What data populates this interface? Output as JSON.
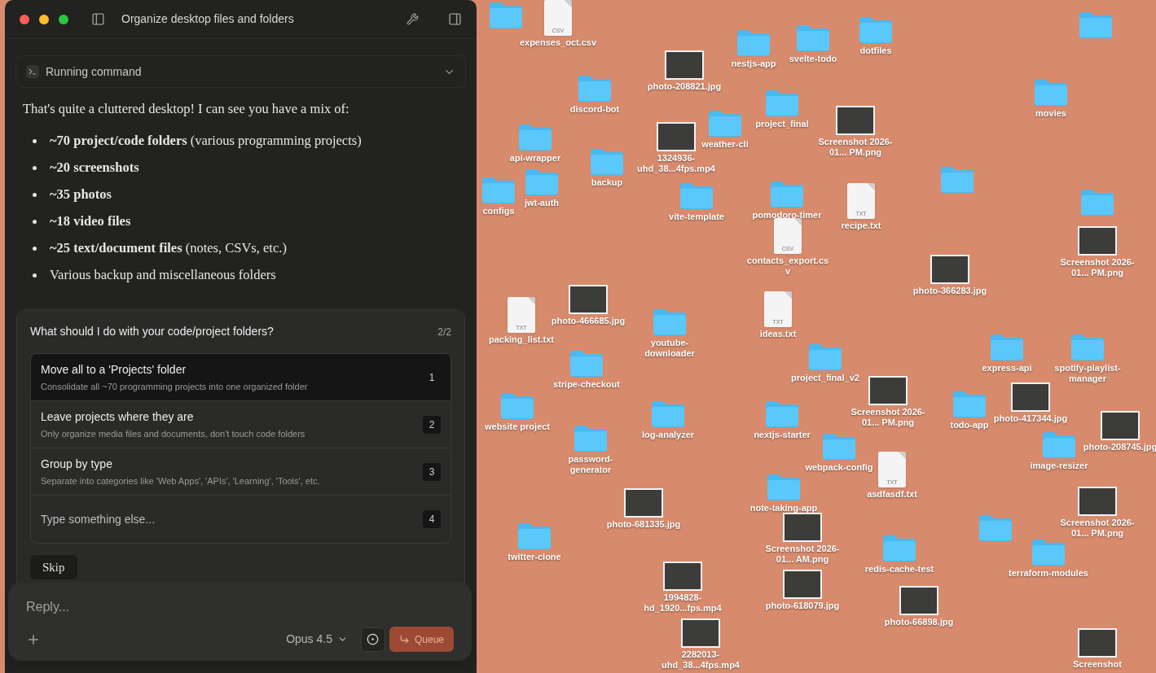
{
  "window": {
    "title": "Organize desktop files and folders"
  },
  "command": {
    "label": "Running command"
  },
  "message": {
    "intro": "That's quite a cluttered desktop! I can see you have a mix of:",
    "bullets": [
      "**~70 project/code folders** (various programming projects)",
      "**~20 screenshots**",
      "**~35 photos**",
      "**~18 video files**",
      "**~25 text/document files** (notes, CSVs, etc.)",
      "Various backup and miscellaneous folders"
    ]
  },
  "question": {
    "title": "What should I do with your code/project folders?",
    "counter": "2/2",
    "options": [
      {
        "kind": "choice",
        "title": "Move all to a 'Projects' folder",
        "description": "Consolidate all ~70 programming projects into one organized folder",
        "number": "1",
        "selected": true
      },
      {
        "kind": "choice",
        "title": "Leave projects where they are",
        "description": "Only organize media files and documents, don't touch code folders",
        "number": "2",
        "selected": false
      },
      {
        "kind": "choice",
        "title": "Group by type",
        "description": "Separate into categories like 'Web Apps', 'APIs', 'Learning', 'Tools', etc.",
        "number": "3",
        "selected": false
      },
      {
        "kind": "custom",
        "placeholder": "Type something else...",
        "number": "4",
        "selected": false
      }
    ],
    "skip": "Skip"
  },
  "composer": {
    "placeholder": "Reply...",
    "model": "Opus 4.5",
    "send": "Queue"
  },
  "desktop": {
    "items": [
      {
        "kind": "folder"
      },
      {
        "kind": "document",
        "type": "CSV",
        "label": "expenses_oct.csv"
      },
      {
        "kind": "folder",
        "label": "nestjs-app"
      },
      {
        "kind": "folder",
        "label": "svelte-todo"
      },
      {
        "kind": "folder",
        "label": "dotfiles"
      },
      {
        "kind": "folder"
      },
      {
        "kind": "image",
        "label": "photo-208821.jpg"
      },
      {
        "kind": "folder",
        "label": "discord-bot"
      },
      {
        "kind": "folder",
        "label": "movies"
      },
      {
        "kind": "folder",
        "label": "project_final"
      },
      {
        "kind": "folder",
        "label": "weather-cli"
      },
      {
        "kind": "image",
        "label": "Screenshot 2026-01... PM.png"
      },
      {
        "kind": "folder",
        "label": "api-wrapper"
      },
      {
        "kind": "image",
        "label": "1324936-uhd_38...4fps.mp4"
      },
      {
        "kind": "folder",
        "label": "backup"
      },
      {
        "kind": "folder",
        "label": "jwt-auth"
      },
      {
        "kind": "folder",
        "label": "configs"
      },
      {
        "kind": "folder",
        "label": "vite-template"
      },
      {
        "kind": "folder",
        "label": "pomodoro-timer"
      },
      {
        "kind": "document",
        "type": "TXT",
        "label": "recipe.txt"
      },
      {
        "kind": "folder"
      },
      {
        "kind": "folder"
      },
      {
        "kind": "document",
        "type": "CSV",
        "label": "contacts_export.csv"
      },
      {
        "kind": "image",
        "label": "Screenshot 2026-01... PM.png"
      },
      {
        "kind": "image",
        "label": "photo-366283.jpg"
      },
      {
        "kind": "image",
        "label": "photo-466685.jpg"
      },
      {
        "kind": "document",
        "type": "TXT",
        "label": "ideas.txt"
      },
      {
        "kind": "document",
        "type": "TXT",
        "label": "packing_list.txt"
      },
      {
        "kind": "folder",
        "label": "youtube-downloader"
      },
      {
        "kind": "folder",
        "label": "stripe-checkout"
      },
      {
        "kind": "folder",
        "label": "project_final_v2"
      },
      {
        "kind": "folder",
        "label": "express-api"
      },
      {
        "kind": "folder",
        "label": "spotify-playlist-manager"
      },
      {
        "kind": "folder",
        "label": "website project"
      },
      {
        "kind": "folder",
        "label": "log-analyzer"
      },
      {
        "kind": "folder",
        "label": "nextjs-starter"
      },
      {
        "kind": "image",
        "label": "Screenshot 2026-01... PM.png"
      },
      {
        "kind": "folder",
        "label": "todo-app"
      },
      {
        "kind": "image",
        "label": "photo-417344.jpg"
      },
      {
        "kind": "image",
        "label": "photo-208745.jpg"
      },
      {
        "kind": "folder",
        "label": "password-generator"
      },
      {
        "kind": "folder",
        "label": "webpack-config"
      },
      {
        "kind": "folder",
        "label": "image-resizer"
      },
      {
        "kind": "document",
        "type": "TXT",
        "label": "asdfasdf.txt"
      },
      {
        "kind": "folder",
        "label": "note-taking-app"
      },
      {
        "kind": "image",
        "label": "photo-681335.jpg"
      },
      {
        "kind": "image",
        "label": "Screenshot 2026-01... PM.png"
      },
      {
        "kind": "folder",
        "label": "twitter-clone"
      },
      {
        "kind": "image",
        "label": "Screenshot 2026-01... AM.png"
      },
      {
        "kind": "folder"
      },
      {
        "kind": "folder",
        "label": "redis-cache-test"
      },
      {
        "kind": "folder",
        "label": "terraform-modules"
      },
      {
        "kind": "image",
        "label": "1994828-hd_1920...fps.mp4"
      },
      {
        "kind": "image",
        "label": "photo-618079.jpg"
      },
      {
        "kind": "image",
        "label": "photo-66898.jpg"
      },
      {
        "kind": "image",
        "label": "2282013-uhd_38...4fps.mp4"
      },
      {
        "kind": "image",
        "label": "Screenshot"
      }
    ]
  }
}
